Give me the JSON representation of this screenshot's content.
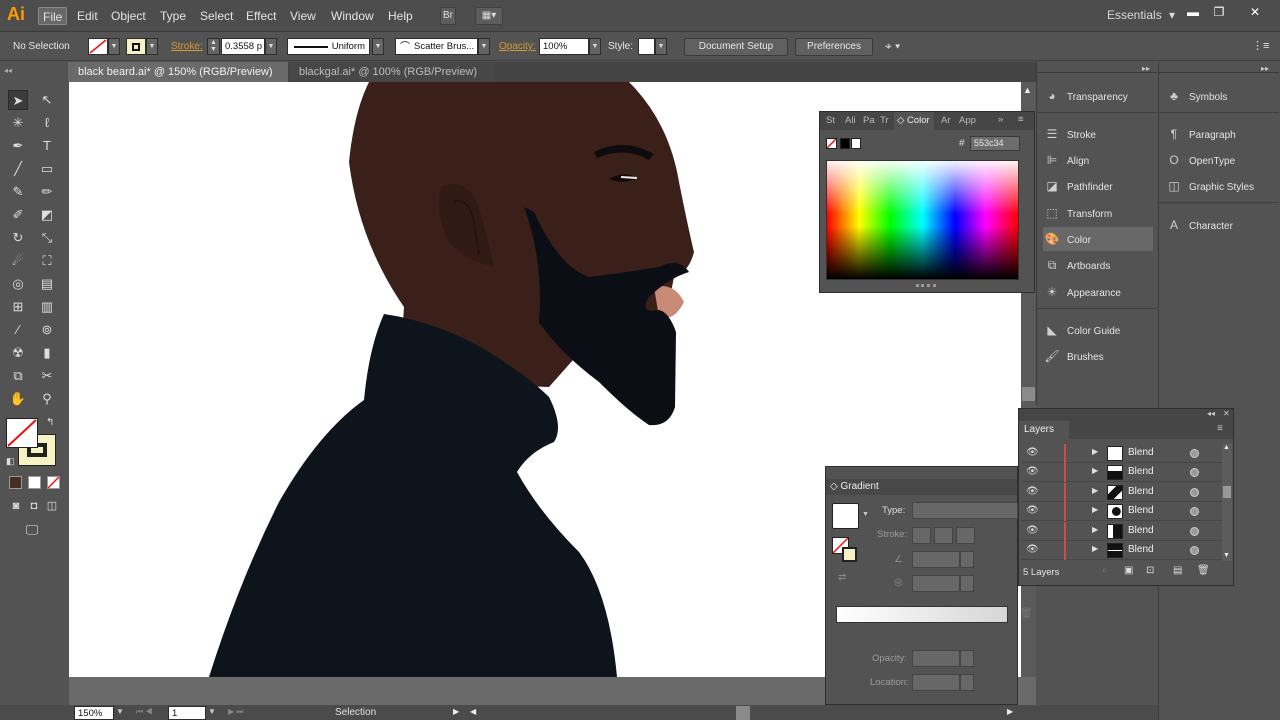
{
  "app": {
    "logo": "Ai",
    "workspace": "Essentials",
    "workspace_arrow": "▾"
  },
  "menu": [
    "File",
    "Edit",
    "Object",
    "Type",
    "Select",
    "Effect",
    "View",
    "Window",
    "Help"
  ],
  "window_controls": {
    "minimize": "▬",
    "restore": "❐",
    "close": "✕"
  },
  "control_bar": {
    "selection": "No Selection",
    "stroke_label": "Stroke:",
    "stroke_weight": "0.3558 p",
    "profile": "Uniform",
    "brush": "Scatter Brus...",
    "opacity_label": "Opacity:",
    "opacity": "100%",
    "style_label": "Style:",
    "document_setup": "Document Setup",
    "preferences": "Preferences"
  },
  "tabs": [
    {
      "label": "black beard.ai* @ 150% (RGB/Preview)",
      "close": "✕"
    },
    {
      "label": "blackgal.ai* @ 100% (RGB/Preview)",
      "close": "✕"
    }
  ],
  "color_panel": {
    "tabs": [
      "St",
      "Ali",
      "Pa",
      "Tr",
      "Color",
      "Ar",
      "App"
    ],
    "hash": "#",
    "hex": "553c34",
    "collapse": "»"
  },
  "dock1_items": [
    "Transparency",
    "Stroke",
    "Align",
    "Pathfinder",
    "Transform",
    "Color",
    "Artboards",
    "Appearance",
    "Color Guide",
    "Brushes"
  ],
  "dock2_items": [
    "Symbols",
    "Paragraph",
    "OpenType",
    "Graphic Styles",
    "Character"
  ],
  "gradient_panel": {
    "title": "Gradient",
    "type_label": "Type:",
    "stroke_label": "Stroke:",
    "opacity_label": "Opacity:",
    "location_label": "Location:"
  },
  "layers_panel": {
    "title": "Layers",
    "rows": [
      "Blend",
      "Blend",
      "Blend",
      "Blend",
      "Blend",
      "Blend"
    ],
    "count": "5 Layers"
  },
  "status_bar": {
    "zoom": "150%",
    "artboard": "1",
    "tool": "Selection"
  },
  "colors": {
    "skin": "#3a2018",
    "beard": "#0b0e14",
    "sweater": "#0d141c",
    "lip": "#c98a76",
    "accent": "#ff9a00"
  }
}
